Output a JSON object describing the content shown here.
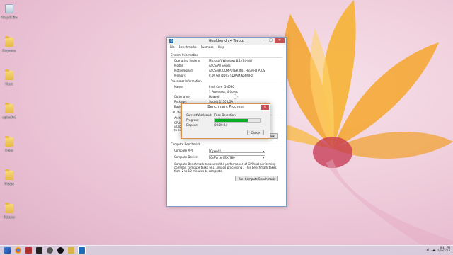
{
  "desktop": {
    "icons": [
      {
        "label": "Recycle Bin",
        "icon": "recycle-bin-icon"
      },
      {
        "label": "Programs",
        "icon": "folder-icon"
      },
      {
        "label": "Music",
        "icon": "folder-icon"
      },
      {
        "label": "uploaded",
        "icon": "folder-icon"
      },
      {
        "label": "Inbox",
        "icon": "folder-icon"
      },
      {
        "label": "Photos",
        "icon": "folder-icon"
      },
      {
        "label": "Pictures",
        "icon": "folder-icon"
      }
    ]
  },
  "window": {
    "title": "Geekbench 4 Tryout",
    "menu": [
      "File",
      "Benchmarks",
      "Purchase",
      "Help"
    ],
    "system": {
      "header": "System Information",
      "rows": [
        {
          "k": "Operating System:",
          "v": "Microsoft Windows 8.1 (64-bit)"
        },
        {
          "k": "Model:",
          "v": "ASUS All Series"
        },
        {
          "k": "Motherboard:",
          "v": "ASUSTeK COMPUTER INC. H87M-D PLUS"
        },
        {
          "k": "Memory:",
          "v": "8.00 GB DDR3 SDRAM 666MHz"
        }
      ]
    },
    "processor": {
      "header": "Processor Information",
      "rows": [
        {
          "k": "Name:",
          "v": "Intel Core i5-4590"
        },
        {
          "k": "",
          "v": "1 Processor, 4 Cores"
        },
        {
          "k": "Codename:",
          "v": "Haswell"
        },
        {
          "k": "Package:",
          "v": "Socket 1150 LGA"
        },
        {
          "k": "Base F",
          "v": ""
        }
      ]
    },
    "cpu": {
      "header": "CPU Be",
      "arch_label": "Archit",
      "desc_lines": [
        "CPU Be",
        "using t",
        "to comp"
      ],
      "button": "Run CPU Benchmark"
    },
    "compute": {
      "header": "Compute Benchmark",
      "api_label": "Compute API:",
      "api_value": "OpenCL",
      "device_label": "Compute Device:",
      "device_value": "GeForce GTX 780",
      "description": "Compute Benchmark measures the performance of GPUs at performing common compute tasks (e.g., image processing). This benchmark takes from 2 to 10 minutes to complete.",
      "button": "Run Compute Benchmark"
    },
    "controls": {
      "minimize": "–",
      "maximize": "□",
      "close": "✕"
    }
  },
  "dialog": {
    "title": "Benchmark Progress",
    "close": "✕",
    "current_label": "Current Workload:",
    "current_value": "Face Detection",
    "progress_label": "Progress:",
    "progress": 0.72,
    "elapsed_label": "Elapsed:",
    "elapsed_value": "00:00:24",
    "cancel": "Cancel"
  },
  "taskbar": {
    "icons": [
      "start-icon",
      "chrome-icon",
      "app-icon",
      "terminal-icon",
      "settings-icon",
      "media-icon",
      "folder-icon",
      "geekbench-icon"
    ],
    "time": "8:41 PM",
    "date": "7/30/2016"
  },
  "colors": {
    "accent": "#1e6bb8",
    "progress": "#06b025",
    "close": "#c75050",
    "dialog_border": "#d9914a"
  }
}
